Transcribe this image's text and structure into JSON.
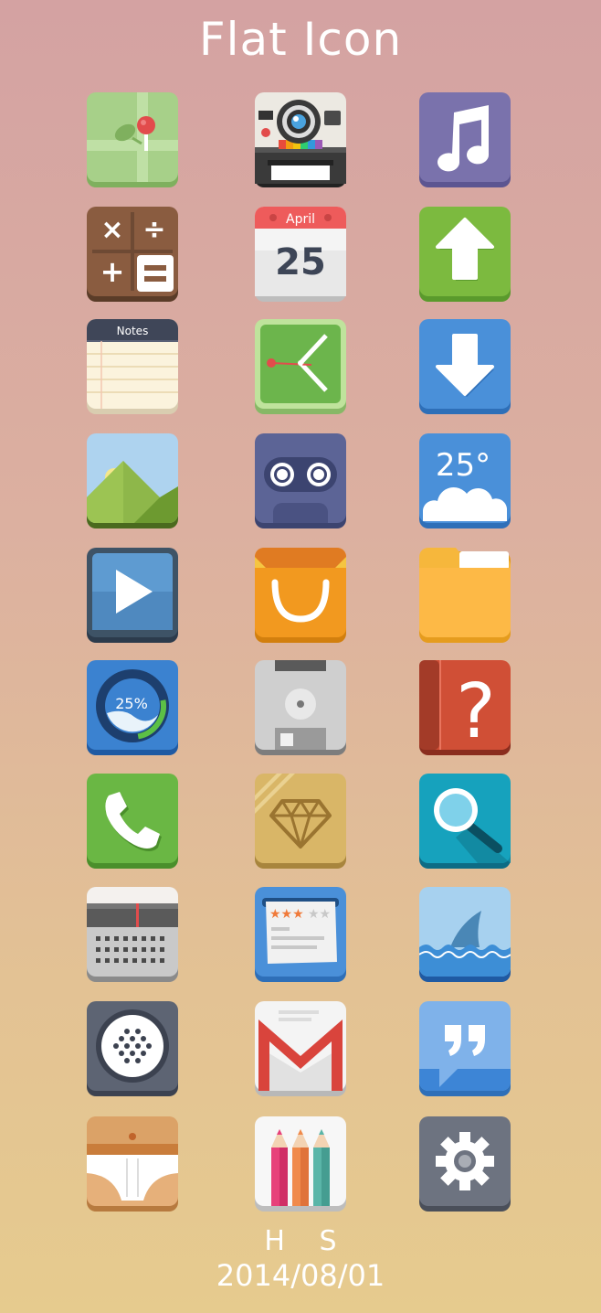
{
  "page": {
    "title": "Flat Icon",
    "author": "H S",
    "date": "2014/08/01"
  },
  "icons": [
    {
      "name": "maps-icon"
    },
    {
      "name": "camera-icon"
    },
    {
      "name": "music-icon"
    },
    {
      "name": "calculator-icon"
    },
    {
      "name": "calendar-icon",
      "month": "April",
      "day": "25"
    },
    {
      "name": "upload-icon"
    },
    {
      "name": "notes-icon",
      "label": "Notes"
    },
    {
      "name": "clock-icon"
    },
    {
      "name": "download-icon"
    },
    {
      "name": "gallery-icon"
    },
    {
      "name": "cassette-icon"
    },
    {
      "name": "weather-icon",
      "temperature": "25°"
    },
    {
      "name": "video-player-icon"
    },
    {
      "name": "shopping-bag-icon"
    },
    {
      "name": "folder-icon"
    },
    {
      "name": "storage-gauge-icon",
      "percent": "25%"
    },
    {
      "name": "floppy-disk-icon"
    },
    {
      "name": "help-book-icon"
    },
    {
      "name": "phone-icon"
    },
    {
      "name": "diamond-icon"
    },
    {
      "name": "search-icon"
    },
    {
      "name": "radio-icon"
    },
    {
      "name": "rating-card-icon"
    },
    {
      "name": "shark-icon"
    },
    {
      "name": "speaker-icon"
    },
    {
      "name": "gmail-icon"
    },
    {
      "name": "quote-message-icon"
    },
    {
      "name": "underwear-icon"
    },
    {
      "name": "pencils-icon"
    },
    {
      "name": "settings-gear-icon"
    }
  ]
}
